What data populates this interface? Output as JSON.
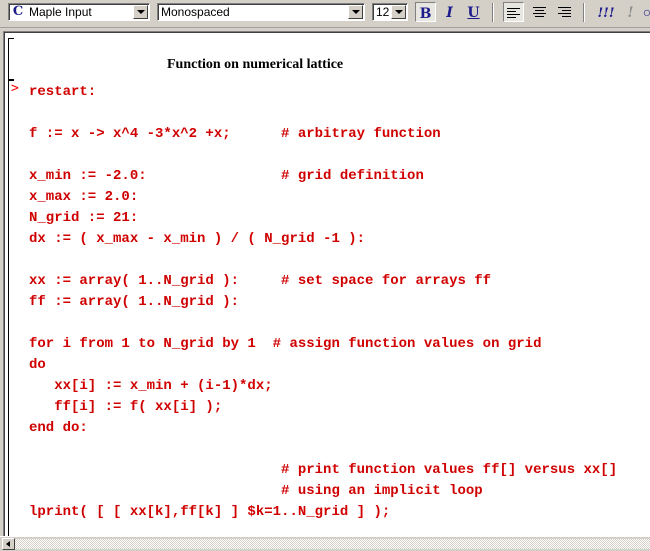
{
  "toolbar": {
    "style_combo": {
      "value": "Maple Input",
      "icon": "maple-c-icon"
    },
    "font_combo": {
      "value": "Monospaced"
    },
    "size_combo": {
      "value": "12"
    },
    "bold_label": "B",
    "italic_label": "I",
    "underline_label": "U",
    "exec_label": "!!!",
    "exec_one_label": "!"
  },
  "document": {
    "section_title": "Function on numerical lattice",
    "prompt": ">",
    "code_lines": [
      "restart:",
      "",
      "f := x -> x^4 -3*x^2 +x;      # arbitray function",
      "",
      "x_min := -2.0:                # grid definition",
      "x_max := 2.0:",
      "N_grid := 21:",
      "dx := ( x_max - x_min ) / ( N_grid -1 ):",
      "",
      "xx := array( 1..N_grid ):     # set space for arrays ff",
      "ff := array( 1..N_grid ):",
      "",
      "for i from 1 to N_grid by 1  # assign function values on grid",
      "do",
      "   xx[i] := x_min + (i-1)*dx;",
      "   ff[i] := f( xx[i] );",
      "end do:",
      "",
      "                              # print function values ff[] versus xx[]",
      "                              # using an implicit loop",
      "lprint( [ [ xx[k],ff[k] ] $k=1..N_grid ] );"
    ]
  },
  "colors": {
    "code_text": "#d00000",
    "prompt": "#ff0000",
    "toolbar_bg": "#d4d0c8"
  }
}
